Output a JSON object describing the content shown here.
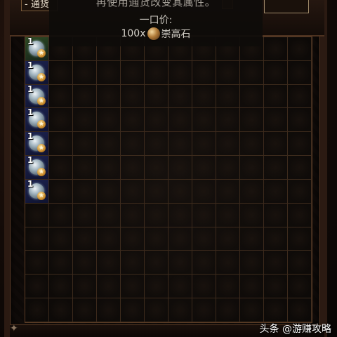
{
  "header": {
    "tab_label": "- 通货",
    "tab_right_label": ""
  },
  "tooltip": {
    "description": "再使用通货改变其属性。",
    "price_label": "一口价:",
    "price_quantity": "100x",
    "price_currency": "崇高石"
  },
  "stash": {
    "columns": 12,
    "rows": 12,
    "items": [
      {
        "row": 0,
        "col": 0,
        "stack": "1",
        "icon": "currency-orb-icon",
        "style": "green"
      },
      {
        "row": 1,
        "col": 0,
        "stack": "1",
        "icon": "currency-orb-icon",
        "style": "blue"
      },
      {
        "row": 2,
        "col": 0,
        "stack": "1",
        "icon": "currency-orb-icon",
        "style": "blue"
      },
      {
        "row": 3,
        "col": 0,
        "stack": "1",
        "icon": "currency-orb-icon",
        "style": "blue"
      },
      {
        "row": 4,
        "col": 0,
        "stack": "1",
        "icon": "currency-orb-icon",
        "style": "blue"
      },
      {
        "row": 5,
        "col": 0,
        "stack": "1",
        "icon": "currency-orb-icon",
        "style": "blue"
      },
      {
        "row": 6,
        "col": 0,
        "stack": "1",
        "icon": "currency-orb-icon",
        "style": "blue"
      }
    ]
  },
  "watermark": "头条 @游赚攻略",
  "colors": {
    "grid_line": "#3c2a1c",
    "frame": "#2b1a12",
    "item_blue_bg": "#1d2350",
    "item_green_bg": "#2e4a24"
  }
}
